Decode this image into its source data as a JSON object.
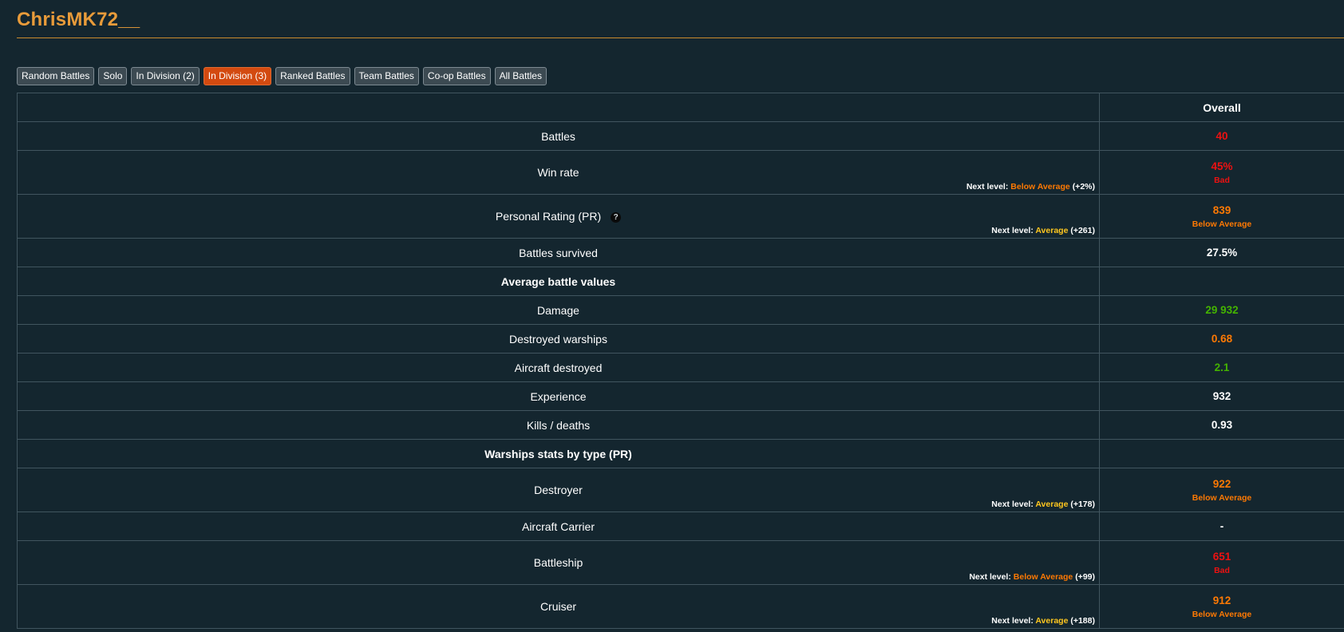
{
  "player": {
    "name": "ChrisMK72__"
  },
  "colors": {
    "title": "#e89b3a",
    "bad": "#ee1111",
    "below_average": "#fe7903",
    "average": "#ffc71f",
    "good": "#44b300",
    "neutral": "#ffffff",
    "tab_active": "#d34a10"
  },
  "tabs": [
    {
      "label": "Random Battles",
      "active": false
    },
    {
      "label": "Solo",
      "active": false
    },
    {
      "label": "In Division (2)",
      "active": false
    },
    {
      "label": "In Division (3)",
      "active": true
    },
    {
      "label": "Ranked Battles",
      "active": false
    },
    {
      "label": "Team Battles",
      "active": false
    },
    {
      "label": "Co-op Battles",
      "active": false
    },
    {
      "label": "All Battles",
      "active": false
    }
  ],
  "table": {
    "column_header": "Overall",
    "next_level_prefix": "Next level:",
    "rows": {
      "battles": {
        "label": "Battles",
        "value": "40",
        "color": "bad"
      },
      "win_rate": {
        "label": "Win rate",
        "value": "45%",
        "rating": "Bad",
        "color": "bad",
        "next_level": "Below Average",
        "next_color": "below_average",
        "next_delta": "(+2%)"
      },
      "pr": {
        "label": "Personal Rating (PR)",
        "icon": "question-circle-icon",
        "value": "839",
        "rating": "Below Average",
        "color": "below_average",
        "next_level": "Average",
        "next_color": "average",
        "next_delta": "(+261)"
      },
      "survived": {
        "label": "Battles survived",
        "value": "27.5%",
        "color": "neutral"
      },
      "avg_section": {
        "label": "Average battle values"
      },
      "damage": {
        "label": "Damage",
        "value": "29 932",
        "color": "good"
      },
      "destroyed_warships": {
        "label": "Destroyed warships",
        "value": "0.68",
        "color": "below_average"
      },
      "aircraft_destroyed": {
        "label": "Aircraft destroyed",
        "value": "2.1",
        "color": "good"
      },
      "experience": {
        "label": "Experience",
        "value": "932",
        "color": "neutral"
      },
      "kd": {
        "label": "Kills / deaths",
        "value": "0.93",
        "color": "neutral"
      },
      "type_section": {
        "label": "Warships stats by type (PR)"
      },
      "destroyer": {
        "label": "Destroyer",
        "value": "922",
        "rating": "Below Average",
        "color": "below_average",
        "next_level": "Average",
        "next_color": "average",
        "next_delta": "(+178)"
      },
      "carrier": {
        "label": "Aircraft Carrier",
        "value": "-",
        "color": "neutral"
      },
      "battleship": {
        "label": "Battleship",
        "value": "651",
        "rating": "Bad",
        "color": "bad",
        "next_level": "Below Average",
        "next_color": "below_average",
        "next_delta": "(+99)"
      },
      "cruiser": {
        "label": "Cruiser",
        "value": "912",
        "rating": "Below Average",
        "color": "below_average",
        "next_level": "Average",
        "next_color": "average",
        "next_delta": "(+188)"
      }
    }
  }
}
